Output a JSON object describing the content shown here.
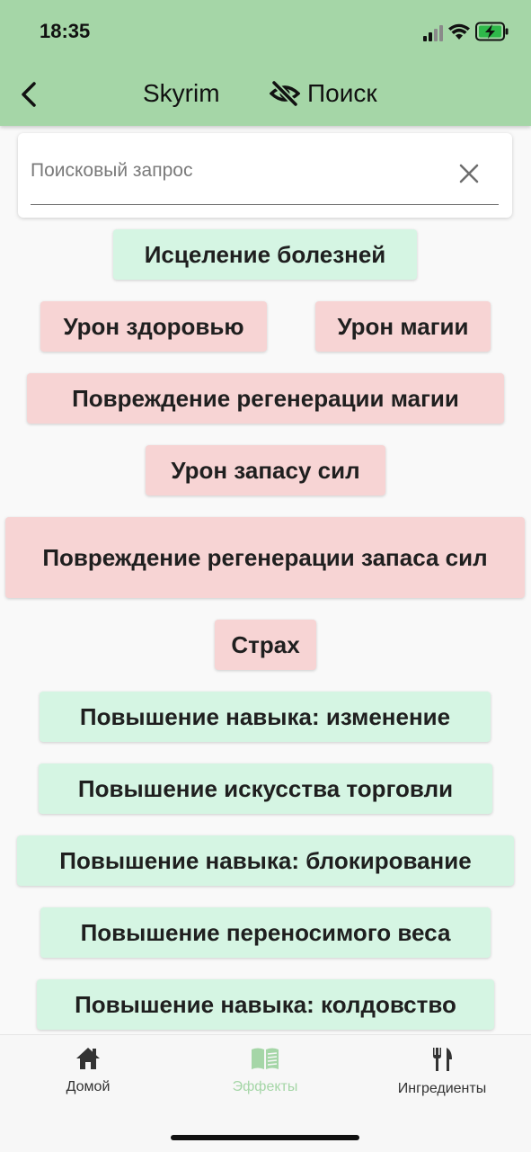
{
  "status_bar": {
    "time": "18:35"
  },
  "app_bar": {
    "back_icon": "chevron-left-icon",
    "title": "Skyrim",
    "toggle_icon": "eye-off-icon",
    "toggle_label": "Поиск"
  },
  "search": {
    "placeholder": "Поисковый запрос",
    "value": "",
    "clear_icon": "close-icon"
  },
  "effects": [
    {
      "label": "Исцеление болезней",
      "kind": "positive"
    },
    {
      "label": "Урон здоровью",
      "kind": "negative"
    },
    {
      "label": "Урон магии",
      "kind": "negative"
    },
    {
      "label": "Повреждение регенерации магии",
      "kind": "negative"
    },
    {
      "label": "Урон запасу сил",
      "kind": "negative"
    },
    {
      "label": "Повреждение регенерации запаса сил",
      "kind": "negative"
    },
    {
      "label": "Страх",
      "kind": "negative"
    },
    {
      "label": "Повышение навыка: изменение",
      "kind": "positive"
    },
    {
      "label": "Повышение искусства торговли",
      "kind": "positive"
    },
    {
      "label": "Повышение навыка: блокирование",
      "kind": "positive"
    },
    {
      "label": "Повышение переносимого веса",
      "kind": "positive"
    },
    {
      "label": "Повышение навыка: колдовство",
      "kind": "positive"
    }
  ],
  "bottom_nav": [
    {
      "label": "Домой",
      "icon": "home-icon",
      "active": false
    },
    {
      "label": "Эффекты",
      "icon": "book-icon",
      "active": true
    },
    {
      "label": "Ингредиенты",
      "icon": "fork-knife-icon",
      "active": false
    }
  ],
  "colors": {
    "app_bar": "#a5d6a7",
    "positive_chip": "#d5f5e3",
    "negative_chip": "#f7d4d4",
    "active_nav": "#a5d6a7"
  }
}
